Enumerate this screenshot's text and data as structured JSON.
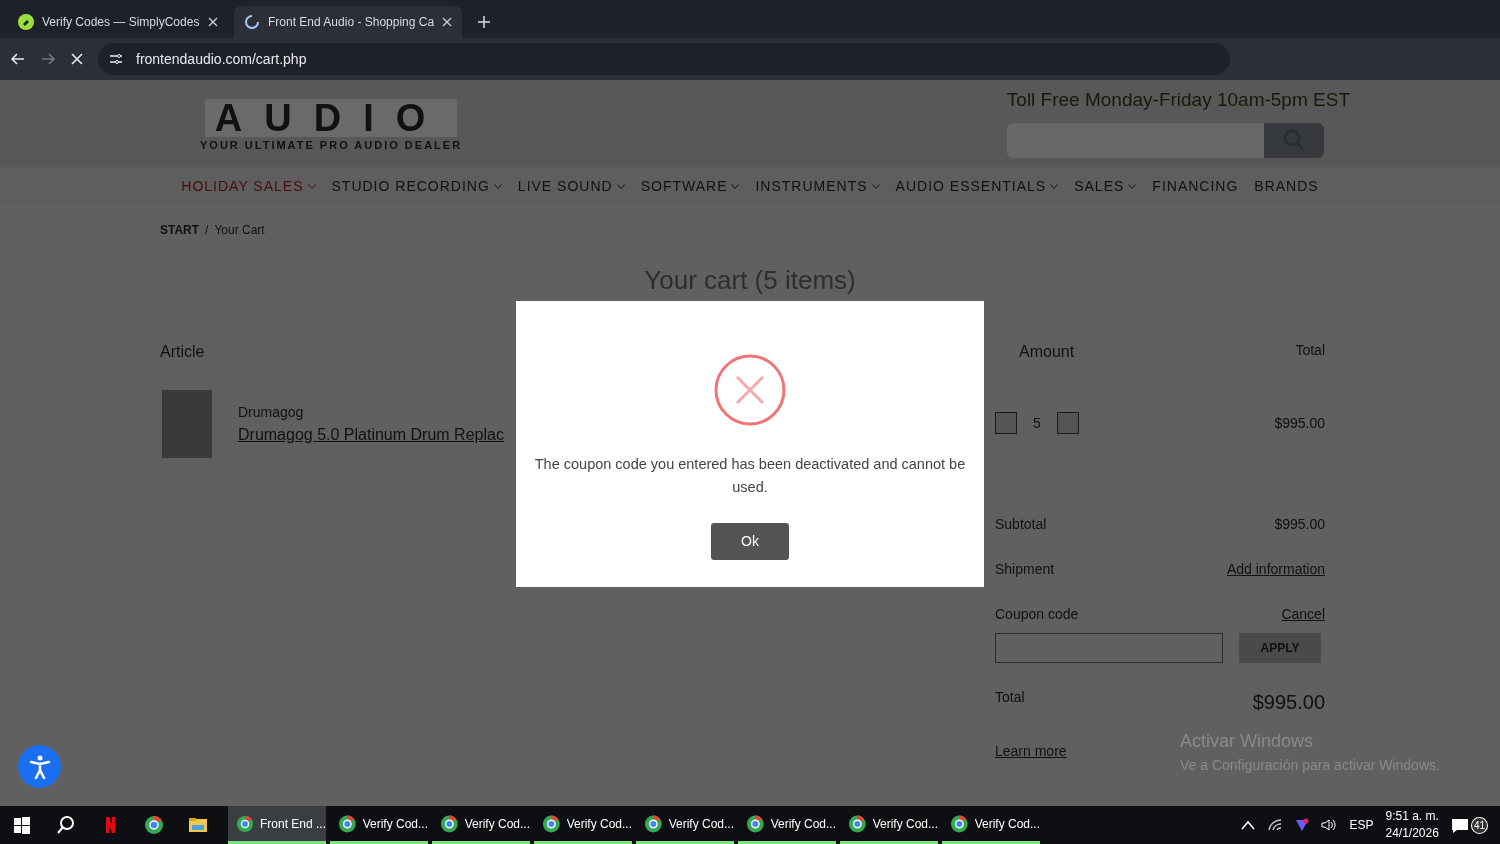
{
  "browser": {
    "tabs": [
      {
        "title": "Verify Codes — SimplyCodes",
        "selected": false,
        "kind": "favicon"
      },
      {
        "title": "Front End Audio - Shopping Ca",
        "selected": true,
        "kind": "loading"
      }
    ],
    "url": "frontendaudio.com/cart.php"
  },
  "header": {
    "logo_word": "AUDIO",
    "logo_tagline": "YOUR ULTIMATE PRO AUDIO DEALER",
    "hours": "Toll Free Monday-Friday 10am-5pm EST"
  },
  "nav": [
    {
      "label": "HOLIDAY SALES",
      "kind": "promo",
      "dropdown": true
    },
    {
      "label": "STUDIO RECORDING",
      "kind": "menu",
      "dropdown": true
    },
    {
      "label": "LIVE SOUND",
      "kind": "menu",
      "dropdown": true
    },
    {
      "label": "SOFTWARE",
      "kind": "menu",
      "dropdown": true
    },
    {
      "label": "INSTRUMENTS",
      "kind": "menu",
      "dropdown": true
    },
    {
      "label": "AUDIO ESSENTIALS",
      "kind": "menu",
      "dropdown": true
    },
    {
      "label": "SALES",
      "kind": "menu",
      "dropdown": true
    },
    {
      "label": "FINANCING",
      "kind": "menu",
      "dropdown": false
    },
    {
      "label": "BRANDS",
      "kind": "menu",
      "dropdown": false
    }
  ],
  "breadcrumb": [
    "START",
    "Your Cart"
  ],
  "breadcrumb_separator": "/",
  "cart": {
    "title": "Your cart (5 items)",
    "columns": [
      "Article",
      "Amount",
      "Total"
    ],
    "items": [
      {
        "brand": "Drumagog",
        "name": "Drumagog 5.0 Platinum Drum Replac",
        "quantity": "5",
        "total": "$995.00"
      }
    ],
    "summary": [
      {
        "label": "Subtotal",
        "value": "$995.00"
      },
      {
        "label": "Shipment",
        "value": "Add information"
      }
    ],
    "coupon": {
      "label": "Coupon code",
      "cancel": "Cancel",
      "button": "APPLY"
    },
    "total": {
      "label": "Total",
      "value": "$995.00"
    },
    "learn_more": "Learn more"
  },
  "modal": {
    "message": "The coupon code you entered has been deactivated and cannot be used.",
    "button": "Ok"
  },
  "activation": {
    "title": "Activar Windows",
    "subtitle": "Ve a Configuración para activar Windows."
  },
  "taskbar": {
    "pinned": [
      {
        "kind": "start"
      },
      {
        "kind": "search"
      },
      {
        "kind": "netflix"
      },
      {
        "kind": "chrome"
      },
      {
        "kind": "folder"
      }
    ],
    "windows": [
      {
        "label": "Front End ...",
        "selected": true
      },
      {
        "label": "Verify Cod...",
        "selected": false
      },
      {
        "label": "Verify Cod...",
        "selected": false
      },
      {
        "label": "Verify Cod...",
        "selected": false
      },
      {
        "label": "Verify Cod...",
        "selected": false
      },
      {
        "label": "Verify Cod...",
        "selected": false
      },
      {
        "label": "Verify Cod...",
        "selected": false
      },
      {
        "label": "Verify Cod...",
        "selected": false
      }
    ],
    "language": "ESP",
    "time": "9:51 a. m.",
    "date": "24/1/2026",
    "notifications": "41"
  }
}
